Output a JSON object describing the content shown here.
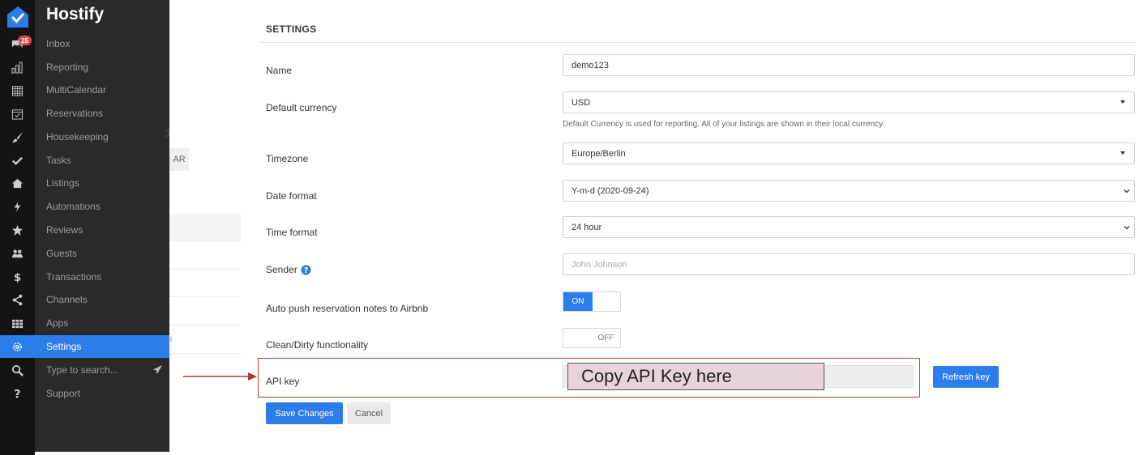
{
  "app": {
    "name": "Hostify",
    "accent": "#2b7de9",
    "annotation_color": "#b03a2e"
  },
  "sidebar": {
    "inbox_badge": "25",
    "items": [
      {
        "label": "Inbox",
        "icon": "chat-bubbles-icon"
      },
      {
        "label": "Reporting",
        "icon": "bar-chart-icon"
      },
      {
        "label": "MultiCalendar",
        "icon": "calendar-grid-icon"
      },
      {
        "label": "Reservations",
        "icon": "calendar-check-icon"
      },
      {
        "label": "Housekeeping",
        "icon": "brush-icon"
      },
      {
        "label": "Tasks",
        "icon": "checkmark-icon"
      },
      {
        "label": "Listings",
        "icon": "home-icon"
      },
      {
        "label": "Automations",
        "icon": "lightning-icon"
      },
      {
        "label": "Reviews",
        "icon": "star-icon"
      },
      {
        "label": "Guests",
        "icon": "users-icon"
      },
      {
        "label": "Transactions",
        "icon": "dollar-icon"
      },
      {
        "label": "Channels",
        "icon": "share-icon"
      },
      {
        "label": "Apps",
        "icon": "apps-grid-icon"
      },
      {
        "label": "Settings",
        "icon": "gear-icon",
        "active": true
      },
      {
        "label": "Type to search...",
        "icon": "search-icon"
      },
      {
        "label": "Support",
        "icon": "question-icon"
      }
    ]
  },
  "background_page": {
    "partial_button": "AR",
    "partial_heading": "3",
    "partial_text": "s"
  },
  "settings": {
    "title": "SETTINGS",
    "name": {
      "label": "Name",
      "value": "demo123"
    },
    "currency": {
      "label": "Default currency",
      "value": "USD",
      "help": "Default Currency is used for reporting. All of your listings are shown in their local currency."
    },
    "timezone": {
      "label": "Timezone",
      "value": "Europe/Berlin"
    },
    "date_format": {
      "label": "Date format",
      "value": "Y-m-d (2020-09-24)"
    },
    "time_format": {
      "label": "Time format",
      "value": "24 hour"
    },
    "sender": {
      "label": "Sender",
      "placeholder": "John Johnson"
    },
    "auto_push": {
      "label": "Auto push reservation notes to Airbnb",
      "state_label": "ON",
      "on": true
    },
    "clean_dirty": {
      "label": "Clean/Dirty functionality",
      "state_label": "OFF",
      "on": false
    },
    "api_key": {
      "label": "API key",
      "callout": "Copy API Key here",
      "refresh_label": "Refresh key"
    },
    "save_label": "Save Changes",
    "cancel_label": "Cancel"
  }
}
